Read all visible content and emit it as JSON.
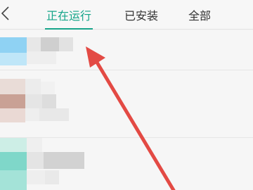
{
  "header": {
    "back_icon": "chevron-left-icon",
    "tabs": [
      {
        "label": "正在运行",
        "active": true
      },
      {
        "label": "已安装",
        "active": false
      },
      {
        "label": "全部",
        "active": false
      }
    ]
  },
  "colors": {
    "accent": "#15a589",
    "arrow": "#e34a44",
    "background": "#f4f4f4"
  },
  "annotation": {
    "icon": "red-arrow-icon"
  }
}
